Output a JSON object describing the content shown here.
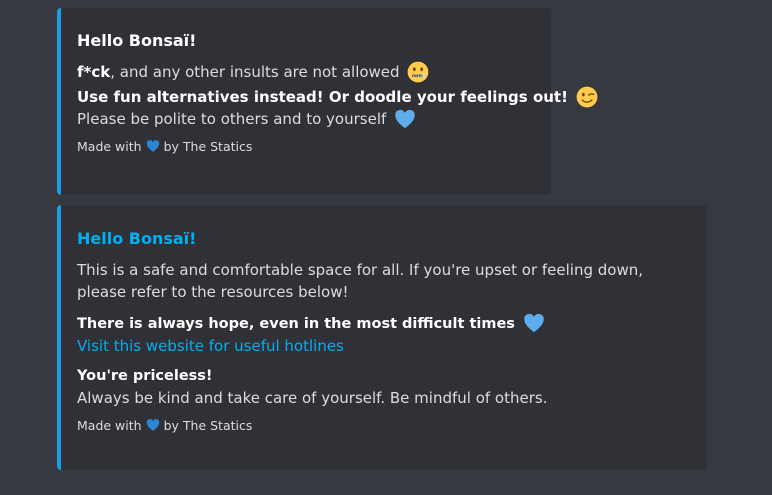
{
  "embeds": [
    {
      "title": "Hello Bonsaï!",
      "line1_bold": "f*ck",
      "line1_rest": ", and any other insults are not allowed",
      "line2": "Use fun alternatives instead! Or doodle your feelings out!",
      "line3": "Please be polite to others and to yourself",
      "footer_prefix": "Made with",
      "footer_suffix": "by The Statics",
      "icons": [
        "zipper-mouth-face-icon",
        "winking-face-icon",
        "blue-heart-icon"
      ]
    },
    {
      "title": "Hello Bonsaï!",
      "description": "This is a safe and comfortable space for all. If you're upset or feeling down, please refer to the resources below!",
      "fields": [
        {
          "name": "There is always hope, even in the most difficult times",
          "value": "Visit this website for useful hotlines"
        },
        {
          "name": "You're priceless!",
          "value": "Always be kind and take care of yourself. Be mindful of others."
        }
      ],
      "footer_prefix": "Made with",
      "footer_suffix": "by The Statics",
      "icons": [
        "blue-heart-icon"
      ]
    }
  ],
  "colors": {
    "background": "#36393f",
    "embed_background": "#2f3136",
    "embed_accent": "#1e9be9",
    "link": "#00aff4",
    "heart": "#5dadec"
  }
}
